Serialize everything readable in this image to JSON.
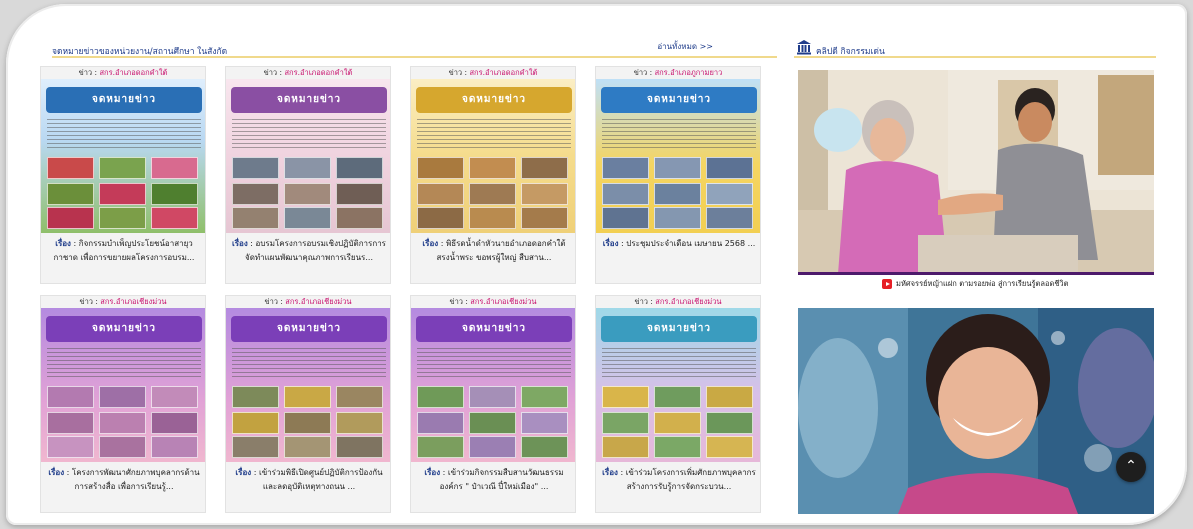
{
  "news_section": {
    "title": "จดหมายข่าวของหน่วยงาน/สถานศึกษา ในสังกัด",
    "read_all": "อ่านทั้งหมด >>"
  },
  "clip_section": {
    "title": "คลิปดี กิจกรรมเด่น",
    "video_caption": "มหัศจรรย์หญ้าแฝก ตามรอยพ่อ สู่การเรียนรู้ตลอดชีวิต"
  },
  "cards": [
    {
      "tag_label": "ข่าว : ",
      "tag_unit": "สกร.อำเภอดอกคำใต้",
      "banner": "จดหมายข่าว",
      "kw": "เรื่อง",
      "caption": " : กิจกรรมบำเพ็ญประโยชน์อาสายุวกาชาด เพื่อการขยายผลโครงการอบรม..."
    },
    {
      "tag_label": "ข่าว : ",
      "tag_unit": "สกร.อำเภอดอกคำใต้",
      "banner": "จดหมายข่าว",
      "kw": "เรื่อง",
      "caption": " : อบรมโครงการอบรมเชิงปฏิบัติการการจัดทำแผนพัฒนาคุณภาพการเรียนร..."
    },
    {
      "tag_label": "ข่าว : ",
      "tag_unit": "สกร.อำเภอดอกคำใต้",
      "banner": "จดหมายข่าว",
      "kw": "เรื่อง",
      "caption": " : พิธีรดน้ำดำหัวนายอำเภอดอกคำใต้ สรงน้ำพระ ขอพรผู้ใหญ่ สืบสาน..."
    },
    {
      "tag_label": "ข่าว : ",
      "tag_unit": "สกร.อำเภอภูกามยาว",
      "banner": "จดหมายข่าว",
      "kw": "เรื่อง",
      "caption": " : ประชุมประจำเดือน เมษายน 2568 ..."
    },
    {
      "tag_label": "ข่าว : ",
      "tag_unit": "สกร.อำเภอเชียงม่วน",
      "banner": "จดหมายข่าว",
      "kw": "เรื่อง",
      "caption": " : โครงการพัฒนาศักยภาพบุคลากรด้านการสร้างสื่อ เพื่อการเรียนรู้..."
    },
    {
      "tag_label": "ข่าว : ",
      "tag_unit": "สกร.อำเภอเชียงม่วน",
      "banner": "จดหมายข่าว",
      "kw": "เรื่อง",
      "caption": " : เข้าร่วมพิธีเปิดศูนย์ปฏิบัติการป้องกันและลดอุบัติเหตุทางถนน ..."
    },
    {
      "tag_label": "ข่าว : ",
      "tag_unit": "สกร.อำเภอเชียงม่วน",
      "banner": "จดหมายข่าว",
      "kw": "เรื่อง",
      "caption": " : เข้าร่วมกิจกรรมสืบสานวัฒนธรรมองค์กร \" ป๋าเวณี ปี๋ใหม่เมือง\" ..."
    },
    {
      "tag_label": "ข่าว : ",
      "tag_unit": "สกร.อำเภอเชียงม่วน",
      "banner": "จดหมายข่าว",
      "kw": "เรื่อง",
      "caption": " : เข้าร่วมโครงการเพิ่มศักยภาพบุคลากรสร้างการรับรู้การจัดกระบวน..."
    }
  ],
  "scroll_top": "⌃",
  "colors": {
    "heading_blue": "#1f3c8a",
    "unit_pink": "#c8106d",
    "accent_gold": "#f0d98c",
    "poster_blue": "#2a6fb5",
    "poster_rose": "#e7b7c9",
    "poster_gold": "#f2cf63",
    "poster_purple": "#9a63c8"
  },
  "icons": [
    "temple-icon",
    "youtube-icon",
    "chevron-up-icon"
  ]
}
